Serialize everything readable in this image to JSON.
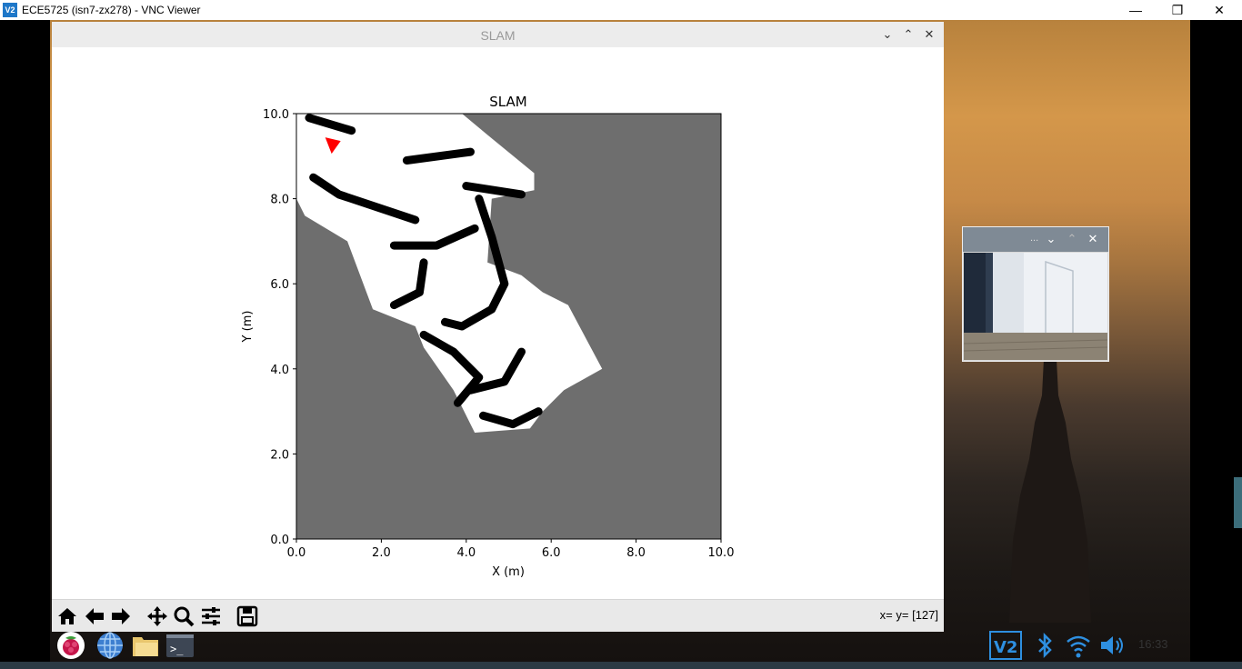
{
  "vnc": {
    "logo": "V2",
    "title": "ECE5725 (isn7-zx278) - VNC Viewer",
    "minimize": "—",
    "maximize": "❐",
    "close": "✕"
  },
  "slam_window": {
    "title": "SLAM",
    "btn_down": "⌄",
    "btn_up": "⌃",
    "btn_close": "✕",
    "coord_readout": "x= y= [127]"
  },
  "toolbar": {
    "icons": [
      "home-icon",
      "back-arrow-icon",
      "forward-arrow-icon",
      "pan-icon",
      "zoom-icon",
      "configure-subplots-icon",
      "save-icon"
    ]
  },
  "camera_window": {
    "title": "...",
    "btn_down": "⌄",
    "btn_up": "⌃",
    "btn_close": "✕"
  },
  "taskbar": {
    "icons": [
      "raspberry-pi-menu-icon",
      "web-browser-icon",
      "file-manager-icon",
      "terminal-icon"
    ],
    "tray_icons": [
      "vnc-icon",
      "bluetooth-icon",
      "wifi-icon",
      "volume-icon"
    ],
    "clock": "16:33"
  },
  "chart_data": {
    "type": "heatmap",
    "title": "SLAM",
    "xlabel": "X (m)",
    "ylabel": "Y (m)",
    "xlim": [
      0.0,
      10.0
    ],
    "ylim": [
      0.0,
      10.0
    ],
    "xticks": [
      "0.0",
      "2.0",
      "4.0",
      "6.0",
      "8.0",
      "10.0"
    ],
    "yticks": [
      "0.0",
      "2.0",
      "4.0",
      "6.0",
      "8.0",
      "10.0"
    ],
    "background_color": "#6e6e6e",
    "free_color": "#ffffff",
    "occupied_color": "#000000",
    "robot_marker": {
      "x": 0.85,
      "y": 9.25,
      "color": "#ff0000"
    },
    "free_regions": [
      [
        [
          0.0,
          10.0
        ],
        [
          3.9,
          10.0
        ],
        [
          4.5,
          9.5
        ],
        [
          5.6,
          8.6
        ],
        [
          5.6,
          8.2
        ],
        [
          4.6,
          8.0
        ],
        [
          4.5,
          6.5
        ],
        [
          5.3,
          6.2
        ],
        [
          5.8,
          5.8
        ],
        [
          6.4,
          5.5
        ],
        [
          7.2,
          4.0
        ],
        [
          6.3,
          3.5
        ],
        [
          5.8,
          3.0
        ],
        [
          5.5,
          2.6
        ],
        [
          4.2,
          2.5
        ],
        [
          3.7,
          3.5
        ],
        [
          3.0,
          4.5
        ],
        [
          2.8,
          5.0
        ],
        [
          1.8,
          5.4
        ],
        [
          1.2,
          7.0
        ],
        [
          0.2,
          7.6
        ],
        [
          0.0,
          8.0
        ]
      ]
    ],
    "walls": [
      [
        [
          0.3,
          9.9
        ],
        [
          1.3,
          9.6
        ]
      ],
      [
        [
          0.4,
          8.5
        ],
        [
          1.0,
          8.1
        ],
        [
          2.8,
          7.5
        ]
      ],
      [
        [
          2.6,
          8.9
        ],
        [
          4.1,
          9.1
        ]
      ],
      [
        [
          4.0,
          8.3
        ],
        [
          5.3,
          8.1
        ]
      ],
      [
        [
          2.3,
          6.9
        ],
        [
          3.3,
          6.9
        ],
        [
          4.2,
          7.3
        ]
      ],
      [
        [
          4.3,
          8.0
        ],
        [
          4.6,
          7.1
        ],
        [
          4.9,
          6.0
        ],
        [
          4.6,
          5.4
        ],
        [
          3.9,
          5.0
        ],
        [
          3.5,
          5.1
        ]
      ],
      [
        [
          3.0,
          6.5
        ],
        [
          2.9,
          5.8
        ],
        [
          2.3,
          5.5
        ]
      ],
      [
        [
          3.0,
          4.8
        ],
        [
          3.7,
          4.4
        ],
        [
          4.3,
          3.8
        ],
        [
          3.8,
          3.2
        ]
      ],
      [
        [
          4.1,
          3.5
        ],
        [
          4.9,
          3.7
        ],
        [
          5.3,
          4.4
        ]
      ],
      [
        [
          4.4,
          2.9
        ],
        [
          5.1,
          2.7
        ],
        [
          5.7,
          3.0
        ]
      ]
    ]
  }
}
